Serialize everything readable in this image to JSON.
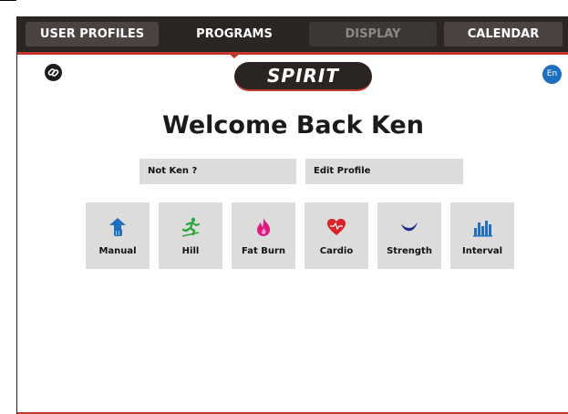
{
  "nav": {
    "tabs": [
      {
        "label": "USER PROFILES"
      },
      {
        "label": "PROGRAMS"
      },
      {
        "label": "DISPLAY"
      },
      {
        "label": "CALENDAR"
      }
    ],
    "active_tab": "PROGRAMS"
  },
  "header": {
    "brand": "SPIRIT",
    "language": "En",
    "link_icon": "link-icon"
  },
  "main": {
    "welcome": "Welcome Back Ken",
    "not_user_label": "Not Ken ?",
    "edit_profile_label": "Edit Profile"
  },
  "programs": [
    {
      "label": "Manual",
      "icon": "manual-icon",
      "color": "#1e6fc0"
    },
    {
      "label": "Hill",
      "icon": "hill-runner-icon",
      "color": "#2aa63a"
    },
    {
      "label": "Fat Burn",
      "icon": "flame-icon",
      "color": "#e0197d"
    },
    {
      "label": "Cardio",
      "icon": "heart-icon",
      "color": "#d9222a"
    },
    {
      "label": "Strength",
      "icon": "strength-icon",
      "color": "#1f2a8c"
    },
    {
      "label": "Interval",
      "icon": "interval-bars-icon",
      "color": "#1e6fc0"
    }
  ],
  "colors": {
    "accent": "#c0392b",
    "topbar": "#2b2523",
    "button_bg": "#dcdcdc"
  }
}
